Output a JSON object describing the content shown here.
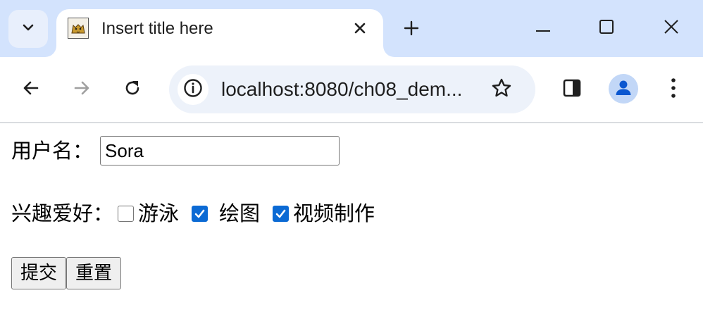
{
  "browser": {
    "tab": {
      "title": "Insert title here"
    },
    "address": {
      "url": "localhost:8080/ch08_dem..."
    }
  },
  "form": {
    "username_label": "用户名：",
    "username_value": "Sora",
    "hobbies_label": "兴趣爱好：",
    "hobbies": [
      {
        "label": "游泳",
        "checked": false
      },
      {
        "label": "绘图",
        "checked": true
      },
      {
        "label": "视频制作",
        "checked": true
      }
    ],
    "submit_label": "提交",
    "reset_label": "重置"
  },
  "colors": {
    "tabstrip_bg": "#d3e3fd",
    "omnibox_bg": "#edf2fa",
    "checkbox_checked": "#0b6ad4"
  }
}
